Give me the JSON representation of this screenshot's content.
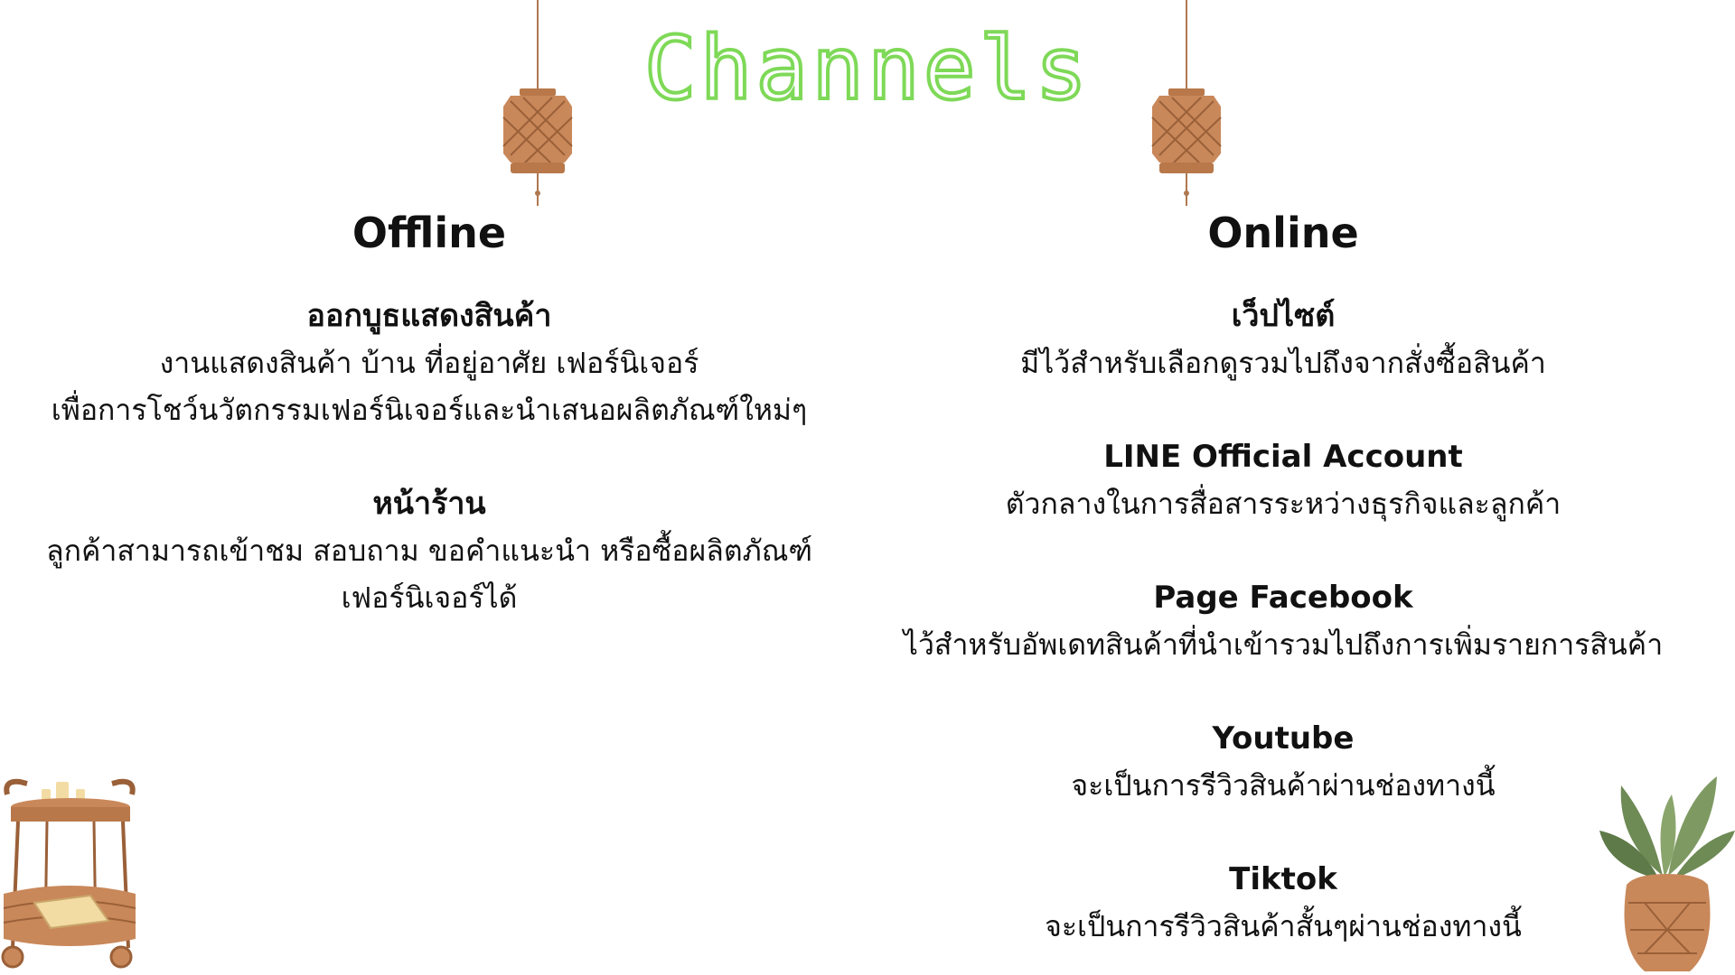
{
  "title": "Channels",
  "offline": {
    "heading": "Offline",
    "items": [
      {
        "title": "ออกบูธแสดงสินค้า",
        "desc": "งานแสดงสินค้า บ้าน ที่อยู่อาศัย เฟอร์นิเจอร์\nเพื่อการโชว์นวัตกรรมเฟอร์นิเจอร์และนำเสนอผลิตภัณฑ์ใหม่ๆ"
      },
      {
        "title": "หน้าร้าน",
        "desc": "ลูกค้าสามารถเข้าชม สอบถาม ขอคำแนะนำ หรือซื้อผลิตภัณฑ์\nเฟอร์นิเจอร์ได้"
      }
    ]
  },
  "online": {
    "heading": "Online",
    "items": [
      {
        "title": "เว็ปไซต์",
        "desc": "มีไว้สำหรับเลือกดูรวมไปถึงจากสั่งซื้อสินค้า"
      },
      {
        "title": "LINE Official Account",
        "desc": "ตัวกลางในการสื่อสารระหว่างธุรกิจและลูกค้า"
      },
      {
        "title": "Page Facebook",
        "desc": "ไว้สำหรับอัพเดทสินค้าที่นำเข้ารวมไปถึงการเพิ่มรายการสินค้า"
      },
      {
        "title": "Youtube",
        "desc": "จะเป็นการรีวิวสินค้าผ่านช่องทางนี้"
      },
      {
        "title": "Tiktok",
        "desc": "จะเป็นการรีวิวสินค้าสั้นๆผ่านช่องทางนี้"
      }
    ]
  },
  "icons": {
    "lamp": "rattan-pendant-lamp-icon",
    "cart": "rattan-serving-cart-icon",
    "plant": "potted-plant-icon"
  },
  "colors": {
    "title_outline": "#7ed957",
    "rattan": "#c9885a",
    "rattan_dark": "#9a6038",
    "leaf": "#6e8a55"
  }
}
